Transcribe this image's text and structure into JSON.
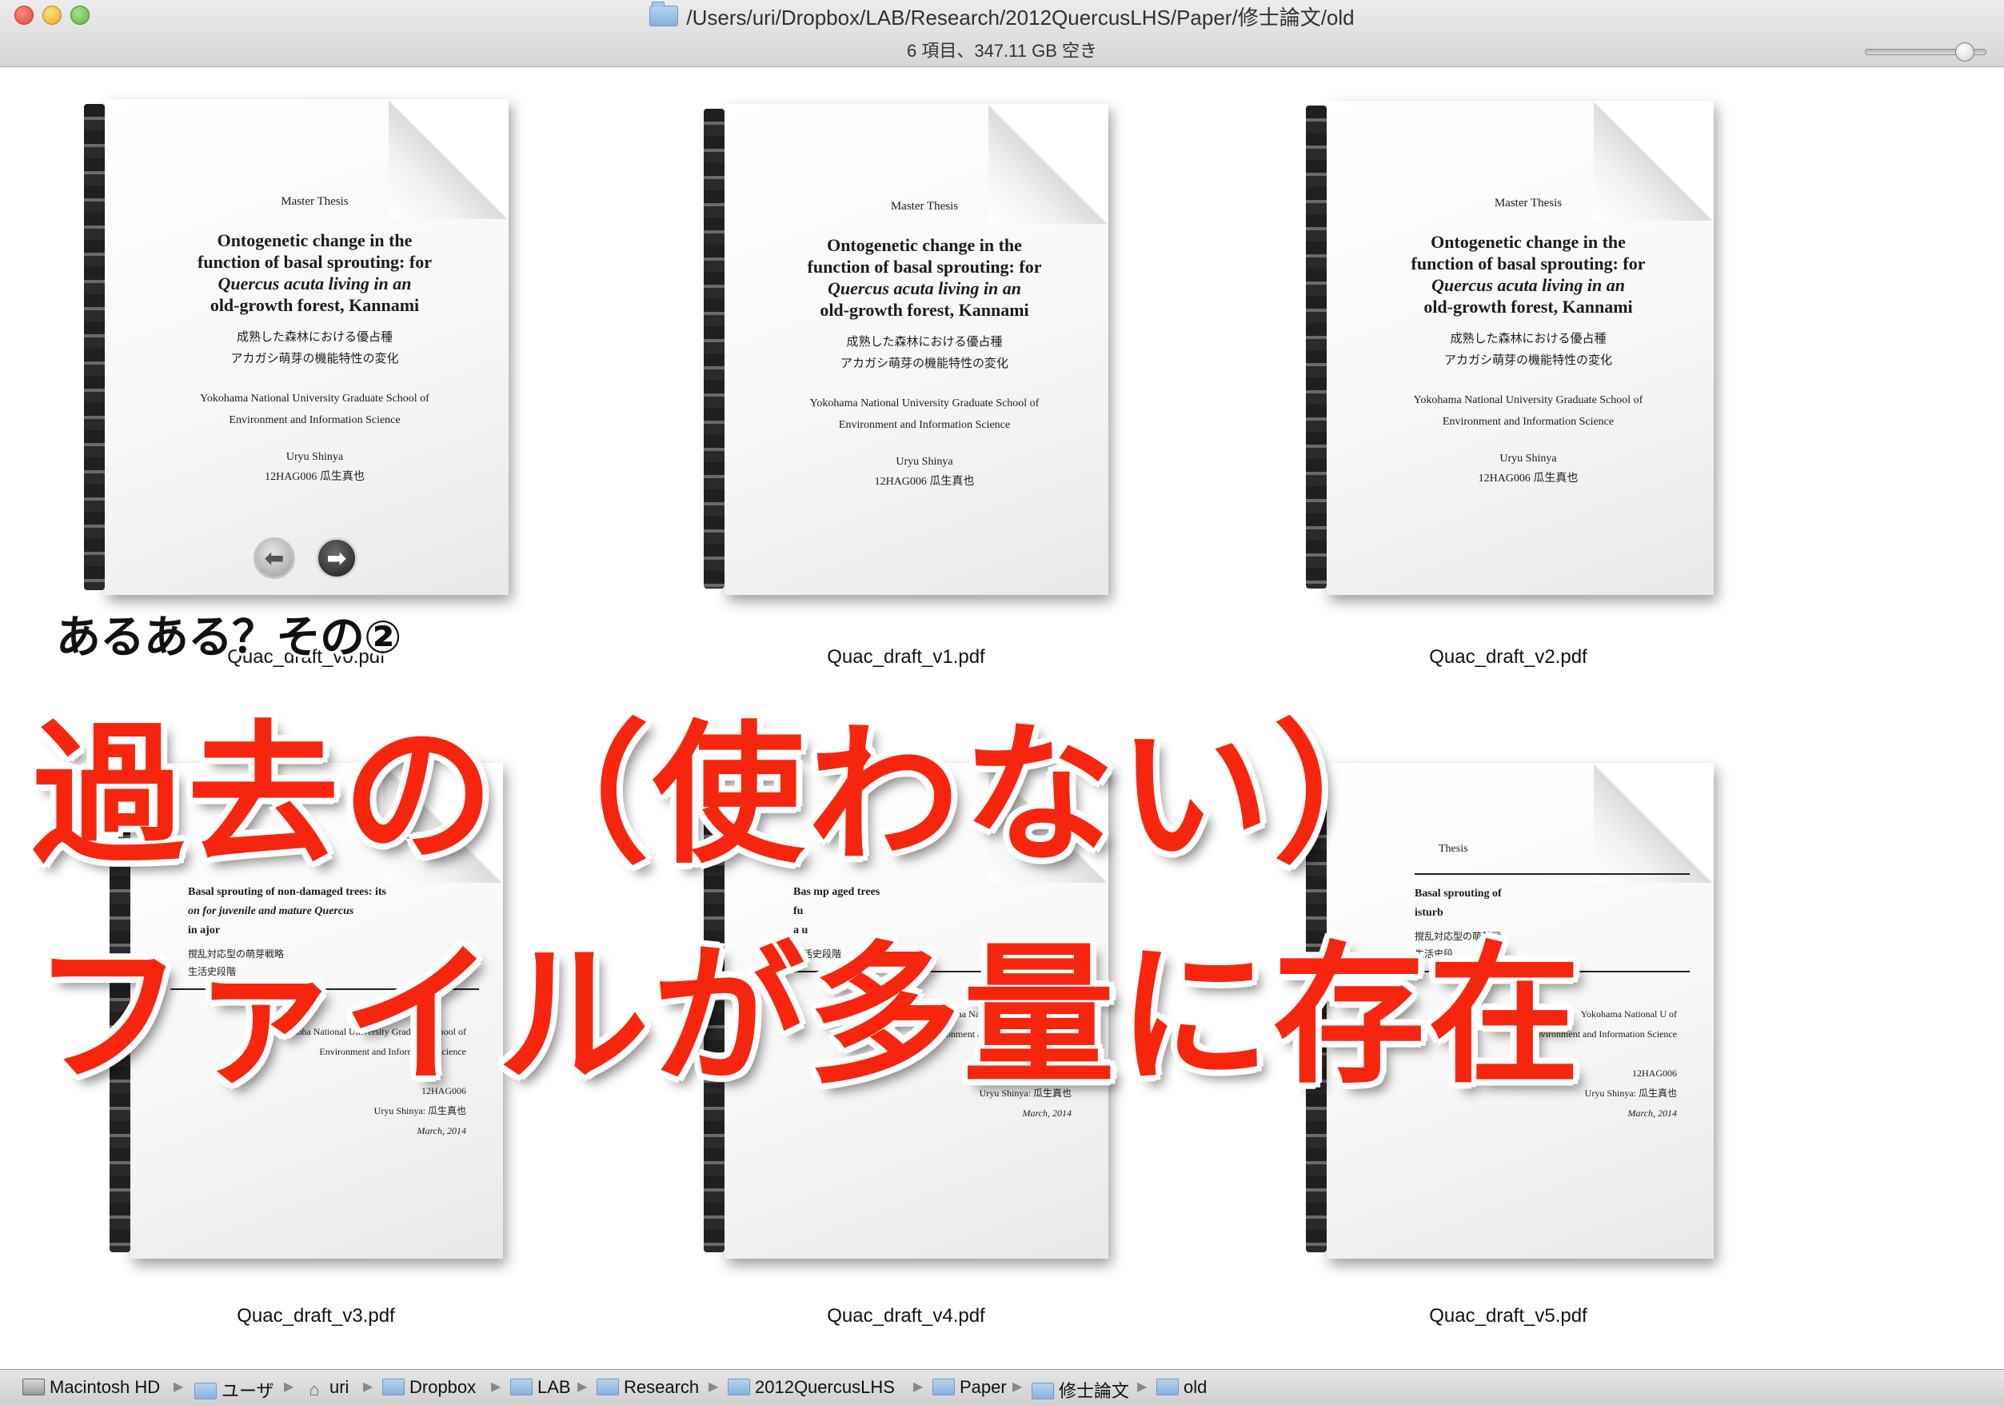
{
  "window": {
    "title": "/Users/uri/Dropbox/LAB/Research/2012QuercusLHS/Paper/修士論文/old",
    "status": "6 項目、347.11 GB 空き"
  },
  "files": [
    {
      "name": "Quac_draft_v0.pdf",
      "label": "Master Thesis",
      "title": [
        "Ontogenetic change in the",
        "function of basal sprouting: for",
        "Quercus acuta living in an",
        "old-growth forest, Kannami"
      ],
      "jp": [
        "成熟した森林における優占種",
        "アカガシ萌芽の機能特性の変化"
      ],
      "inst": [
        "Yokohama National University Graduate School of",
        "Environment and Information Science"
      ],
      "author": [
        "Uryu Shinya",
        "12HAG006 瓜生真也"
      ]
    },
    {
      "name": "Quac_draft_v1.pdf",
      "label": "Master Thesis",
      "title": [
        "Ontogenetic change in the",
        "function of basal sprouting: for",
        "Quercus acuta living in an",
        "old-growth forest, Kannami"
      ],
      "jp": [
        "成熟した森林における優占種",
        "アカガシ萌芽の機能特性の変化"
      ],
      "inst": [
        "Yokohama National University Graduate School of",
        "Environment and Information Science"
      ],
      "author": [
        "Uryu Shinya",
        "12HAG006 瓜生真也"
      ]
    },
    {
      "name": "Quac_draft_v2.pdf",
      "label": "Master Thesis",
      "title": [
        "Ontogenetic change in the",
        "function of basal sprouting: for",
        "Quercus acuta living in an",
        "old-growth forest, Kannami"
      ],
      "jp": [
        "成熟した森林における優占種",
        "アカガシ萌芽の機能特性の変化"
      ],
      "inst": [
        "Yokohama National University Graduate School of",
        "Environment and Information Science"
      ],
      "author": [
        "Uryu Shinya",
        "12HAG006 瓜生真也"
      ]
    },
    {
      "name": "Quac_draft_v3.pdf",
      "title": [
        "Basal sprouting of non-damaged trees: its",
        "on for juvenile and mature Quercus",
        "in                    ajor"
      ],
      "jp": [
        "撹乱対応型の萌芽戦略",
        "生活史段階"
      ],
      "inst": [
        "Yokoha   National University Graduate School of",
        "Environment and Information Science"
      ],
      "author": [
        "12HAG006",
        "Uryu Shinya: 瓜生真也",
        "March, 2014"
      ]
    },
    {
      "name": "Quac_draft_v4.pdf",
      "title": [
        "Bas    mp         aged trees",
        "fu",
        "a   u"
      ],
      "jp": [
        "生活史段階"
      ],
      "inst": [
        "Yokohama National University Gra          of",
        "Environment and Information Science"
      ],
      "author": [
        "12HAG006",
        "Uryu Shinya: 瓜生真也",
        "March, 2014"
      ]
    },
    {
      "name": "Quac_draft_v5.pdf",
      "label": "Thesis",
      "title": [
        "Basal sprouting of",
        "isturb"
      ],
      "jp": [
        "撹乱対応型の萌芽戦",
        "生活史段"
      ],
      "inst": [
        "Yokohama National U                  of",
        "Environment and Information Science"
      ],
      "author": [
        "12HAG006",
        "Uryu Shinya: 瓜生真也",
        "March, 2014"
      ]
    }
  ],
  "quicklook": {
    "prev_icon": "arrow-left-icon",
    "next_icon": "arrow-right-icon",
    "prev": "⬅",
    "next": "➡"
  },
  "overlay": {
    "caption": "あるある？その②",
    "line1": "過去の（使わない）",
    "line2": "ファイルが多量に存在",
    "color": "#f6260e"
  },
  "pathbar": {
    "crumbs": [
      "Macintosh HD",
      "ユーザ",
      "uri",
      "Dropbox",
      "LAB",
      "Research",
      "2012QuercusLHS",
      "Paper",
      "修士論文",
      "old"
    ],
    "separator": "▶"
  }
}
